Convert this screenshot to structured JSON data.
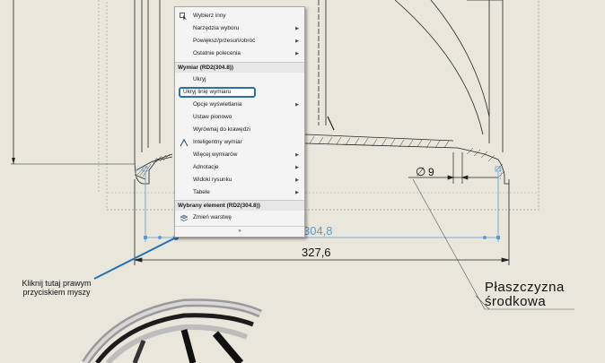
{
  "context_menu": {
    "items_top": [
      {
        "label": "Wybierz inny",
        "icon": "select-other-icon",
        "submenu": false
      },
      {
        "label": "Narzędzia wyboru",
        "submenu": true
      },
      {
        "label": "Powiększ/przesuń/obróć",
        "submenu": true
      },
      {
        "label": "Ostatnie polecenia",
        "submenu": true
      }
    ],
    "section_dimension": "Wymiar (RD2(304.8))",
    "items_dimension": [
      {
        "label": "Ukryj",
        "submenu": false
      },
      {
        "label": "Ukryj linię wymiaru",
        "submenu": false,
        "highlighted": true
      },
      {
        "label": "Opcje wyświetlania",
        "submenu": true
      },
      {
        "label": "Ustaw pionowo",
        "submenu": false
      },
      {
        "label": "Wyrównaj do krawędzi",
        "submenu": false
      },
      {
        "label": "Inteligentny wymiar",
        "icon": "smart-dimension-icon",
        "submenu": false
      },
      {
        "label": "Więcej wymiarów",
        "submenu": true
      },
      {
        "label": "Adnotacje",
        "submenu": true
      },
      {
        "label": "Widoki rysunku",
        "submenu": true
      },
      {
        "label": "Tabele",
        "submenu": true
      }
    ],
    "section_selected": "Wybrany element (RD2(304.8))",
    "items_selected": [
      {
        "label": "Zmień warstwę",
        "icon": "layer-icon",
        "submenu": false
      }
    ],
    "expand_glyph": "»"
  },
  "drawing": {
    "dim_selected": "304,8",
    "dim_overall": "327,6",
    "dim_diameter_symbol": "∅",
    "dim_diameter": "9",
    "callout_text": "Kliknij tutaj prawym przyciskiem myszy",
    "plane_label_line1": "Płaszczyzna",
    "plane_label_line2": "środkowa"
  },
  "colors": {
    "background": "#e9e7dc",
    "selected_dimension": "#5b9bd5",
    "callout_line": "#2a6fb4",
    "highlight_border": "#2f6db2"
  }
}
